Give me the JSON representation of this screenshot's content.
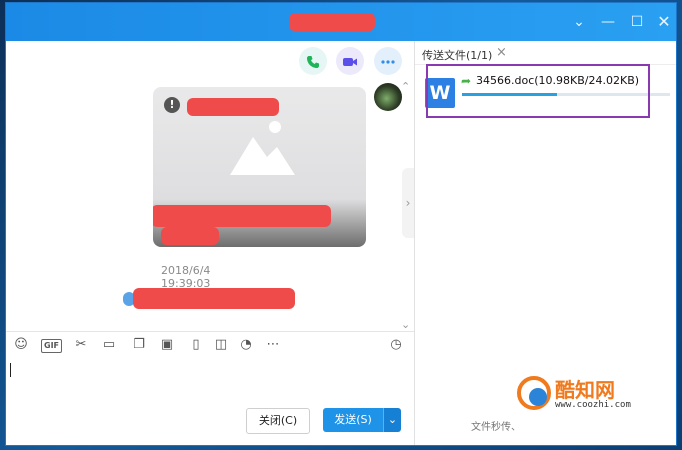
{
  "window": {
    "minimize": "⌄",
    "restore": "—",
    "maximize": "☐",
    "close": "✕"
  },
  "chat": {
    "timestamp": "2018/6/4 19:39:03",
    "actions": {
      "call_icon": "phone-icon",
      "video_icon": "video-icon",
      "more_icon": "more-icon"
    }
  },
  "toolbar": {
    "emoji": "☺",
    "gif": "GIF",
    "scissors": "✂",
    "folder": "▭",
    "fav": "❐",
    "image": "▣",
    "shake": "▯",
    "box": "◫",
    "music": "◔",
    "more": "⋯",
    "history": "◷"
  },
  "buttons": {
    "close_label": "关闭(C)",
    "send_label": "发送(S)",
    "send_dropdown": "⌄"
  },
  "panel": {
    "tab_label": "传送文件(1/1)",
    "tab_close": "×",
    "file_icon_letter": "W",
    "file_name": "34566.doc(10.98KB/24.02KB)",
    "progress": 0.457,
    "footer": "文件秒传、"
  },
  "watermark": {
    "title": "酷知网",
    "url": "www.coozhi.com"
  },
  "colors": {
    "accent": "#1e93e8",
    "redaction": "#ef4b4b",
    "highlight": "#8a3ab1",
    "logo_orange": "#f07a1e"
  }
}
